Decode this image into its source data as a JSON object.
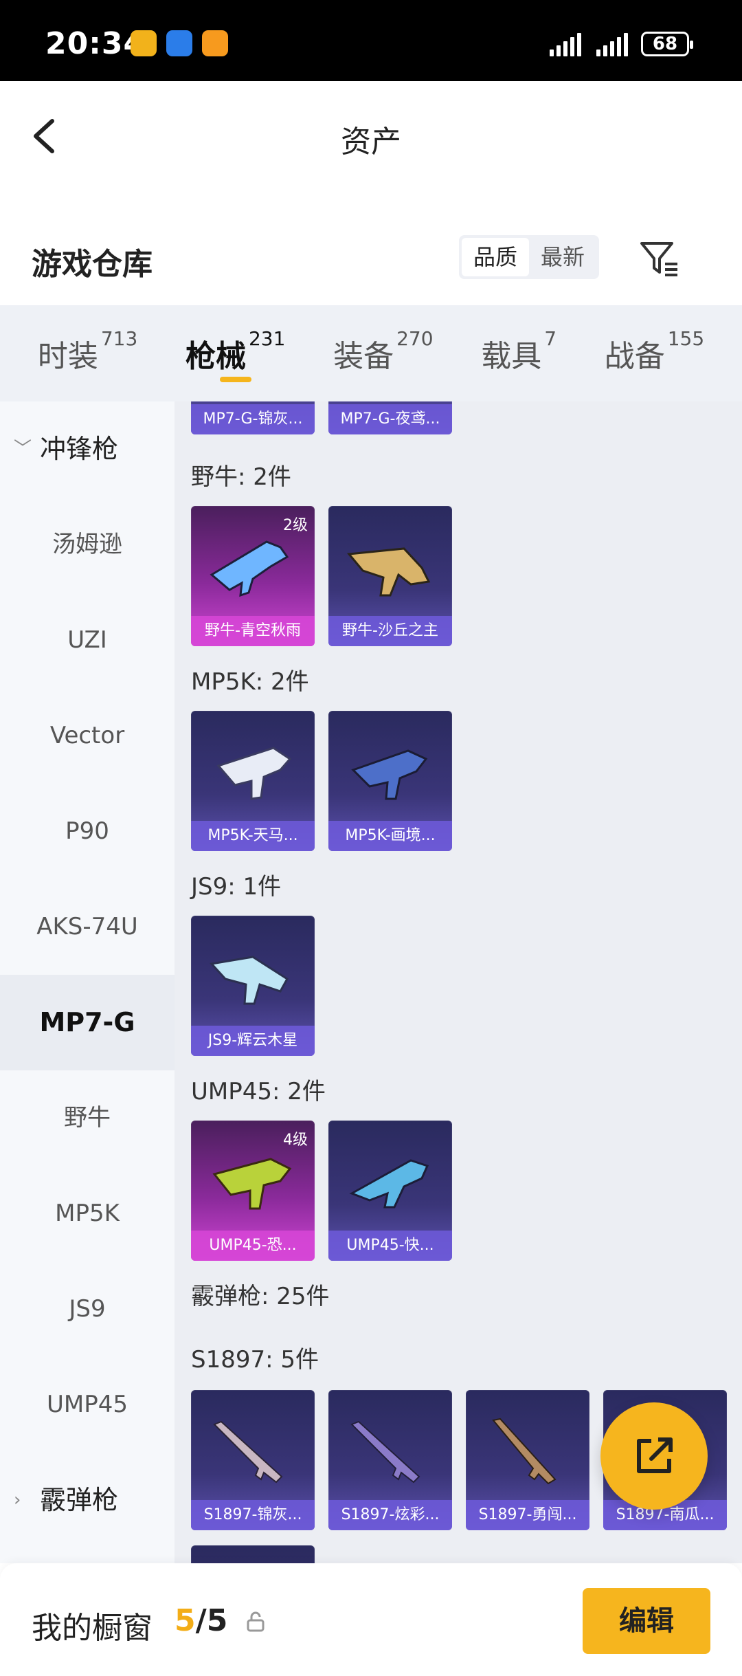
{
  "status_bar": {
    "time": "20:34",
    "battery": "68"
  },
  "header": {
    "title": "资产"
  },
  "section": {
    "title": "游戏仓库",
    "sort_options": [
      "品质",
      "最新"
    ],
    "active_sort": "品质"
  },
  "tabs": [
    {
      "label": "时装",
      "count": "713"
    },
    {
      "label": "枪械",
      "count": "231",
      "active": true
    },
    {
      "label": "装备",
      "count": "270"
    },
    {
      "label": "载具",
      "count": "7"
    },
    {
      "label": "战备",
      "count": "155"
    }
  ],
  "sidebar": {
    "items": [
      {
        "label": "冲锋枪",
        "type": "group",
        "expanded": true
      },
      {
        "label": "汤姆逊"
      },
      {
        "label": "UZI"
      },
      {
        "label": "Vector"
      },
      {
        "label": "P90"
      },
      {
        "label": "AKS-74U"
      },
      {
        "label": "MP7-G",
        "selected": true
      },
      {
        "label": "野牛"
      },
      {
        "label": "MP5K"
      },
      {
        "label": "JS9"
      },
      {
        "label": "UMP45"
      },
      {
        "label": "霰弹枪",
        "type": "group",
        "expanded": false
      }
    ]
  },
  "content": {
    "top_partial_cards": [
      "MP7-G-锦灰...",
      "MP7-G-夜鸢..."
    ],
    "groups": [
      {
        "label": "野牛: 2件",
        "cards": [
          {
            "name": "野牛-青空秋雨",
            "level": "2级",
            "rarity": "purple"
          },
          {
            "name": "野牛-沙丘之主",
            "rarity": "blue"
          }
        ]
      },
      {
        "label": "MP5K: 2件",
        "cards": [
          {
            "name": "MP5K-天马...",
            "rarity": "blue"
          },
          {
            "name": "MP5K-画境...",
            "rarity": "blue"
          }
        ]
      },
      {
        "label": "JS9: 1件",
        "cards": [
          {
            "name": "JS9-辉云木星",
            "rarity": "blue"
          }
        ]
      },
      {
        "label": "UMP45: 2件",
        "cards": [
          {
            "name": "UMP45-恐...",
            "level": "4级",
            "rarity": "purple"
          },
          {
            "name": "UMP45-快...",
            "rarity": "blue"
          }
        ]
      }
    ],
    "category_label": "霰弹枪: 25件",
    "shotgun_group": {
      "label": "S1897: 5件",
      "cards": [
        {
          "name": "S1897-锦灰..."
        },
        {
          "name": "S1897-炫彩..."
        },
        {
          "name": "S1897-勇闯..."
        },
        {
          "name": "S1897-南瓜..."
        }
      ]
    }
  },
  "bottom_bar": {
    "label": "我的橱窗",
    "current": "5",
    "separator": "/",
    "total": "5",
    "edit_label": "编辑"
  },
  "colors": {
    "accent": "#f6b51e",
    "card_blue": "#3a3578",
    "card_purple": "#d046d4"
  }
}
